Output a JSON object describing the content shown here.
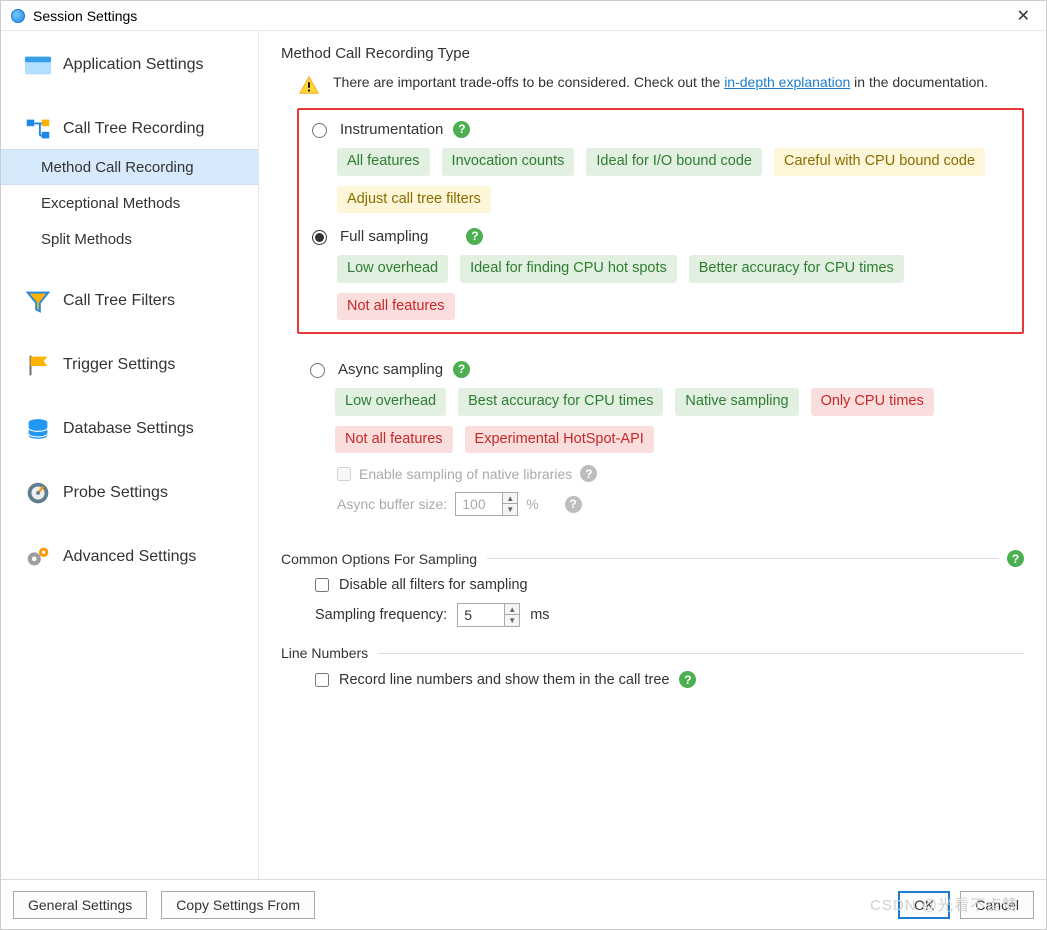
{
  "window": {
    "title": "Session Settings"
  },
  "sidebar": {
    "items": [
      {
        "label": "Application Settings"
      },
      {
        "label": "Call Tree Recording",
        "children": [
          {
            "label": "Method Call Recording",
            "selected": true
          },
          {
            "label": "Exceptional Methods"
          },
          {
            "label": "Split Methods"
          }
        ]
      },
      {
        "label": "Call Tree Filters"
      },
      {
        "label": "Trigger Settings"
      },
      {
        "label": "Database Settings"
      },
      {
        "label": "Probe Settings"
      },
      {
        "label": "Advanced Settings"
      }
    ]
  },
  "main": {
    "section_title": "Method Call Recording Type",
    "info_pre": "There are important trade-offs to be considered. Check out the ",
    "info_link": "in-depth explanation",
    "info_post": " in the documentation.",
    "radios": {
      "instrumentation": {
        "label": "Instrumentation",
        "checked": false,
        "tags": [
          {
            "text": "All features",
            "kind": "green"
          },
          {
            "text": "Invocation counts",
            "kind": "green"
          },
          {
            "text": "Ideal for I/O bound code",
            "kind": "green"
          },
          {
            "text": "Careful with CPU bound code",
            "kind": "yellow"
          },
          {
            "text": "Adjust call tree filters",
            "kind": "yellow"
          }
        ]
      },
      "full_sampling": {
        "label": "Full sampling",
        "checked": true,
        "tags": [
          {
            "text": "Low overhead",
            "kind": "green"
          },
          {
            "text": "Ideal for finding CPU hot spots",
            "kind": "green"
          },
          {
            "text": "Better accuracy for CPU times",
            "kind": "green"
          },
          {
            "text": "Not all features",
            "kind": "red"
          }
        ]
      },
      "async_sampling": {
        "label": "Async sampling",
        "checked": false,
        "tags": [
          {
            "text": "Low overhead",
            "kind": "green"
          },
          {
            "text": "Best accuracy for CPU times",
            "kind": "green"
          },
          {
            "text": "Native sampling",
            "kind": "green"
          },
          {
            "text": "Only CPU times",
            "kind": "red"
          },
          {
            "text": "Not all features",
            "kind": "red"
          },
          {
            "text": "Experimental HotSpot-API",
            "kind": "red"
          }
        ],
        "native_checkbox_label": "Enable sampling of native libraries",
        "buffer_label": "Async buffer size:",
        "buffer_value": "100",
        "buffer_unit": "%"
      }
    },
    "common": {
      "heading": "Common Options For Sampling",
      "disable_filters_label": "Disable all filters for sampling",
      "disable_filters_checked": false,
      "freq_label": "Sampling frequency:",
      "freq_value": "5",
      "freq_unit": "ms"
    },
    "line_numbers": {
      "heading": "Line Numbers",
      "checkbox_label": "Record line numbers and show them in the call tree",
      "checked": false
    }
  },
  "footer": {
    "general": "General Settings",
    "copy": "Copy Settings From",
    "ok": "OK",
    "cancel": "Cancel",
    "watermark": "CSDN @光看不点赞"
  }
}
